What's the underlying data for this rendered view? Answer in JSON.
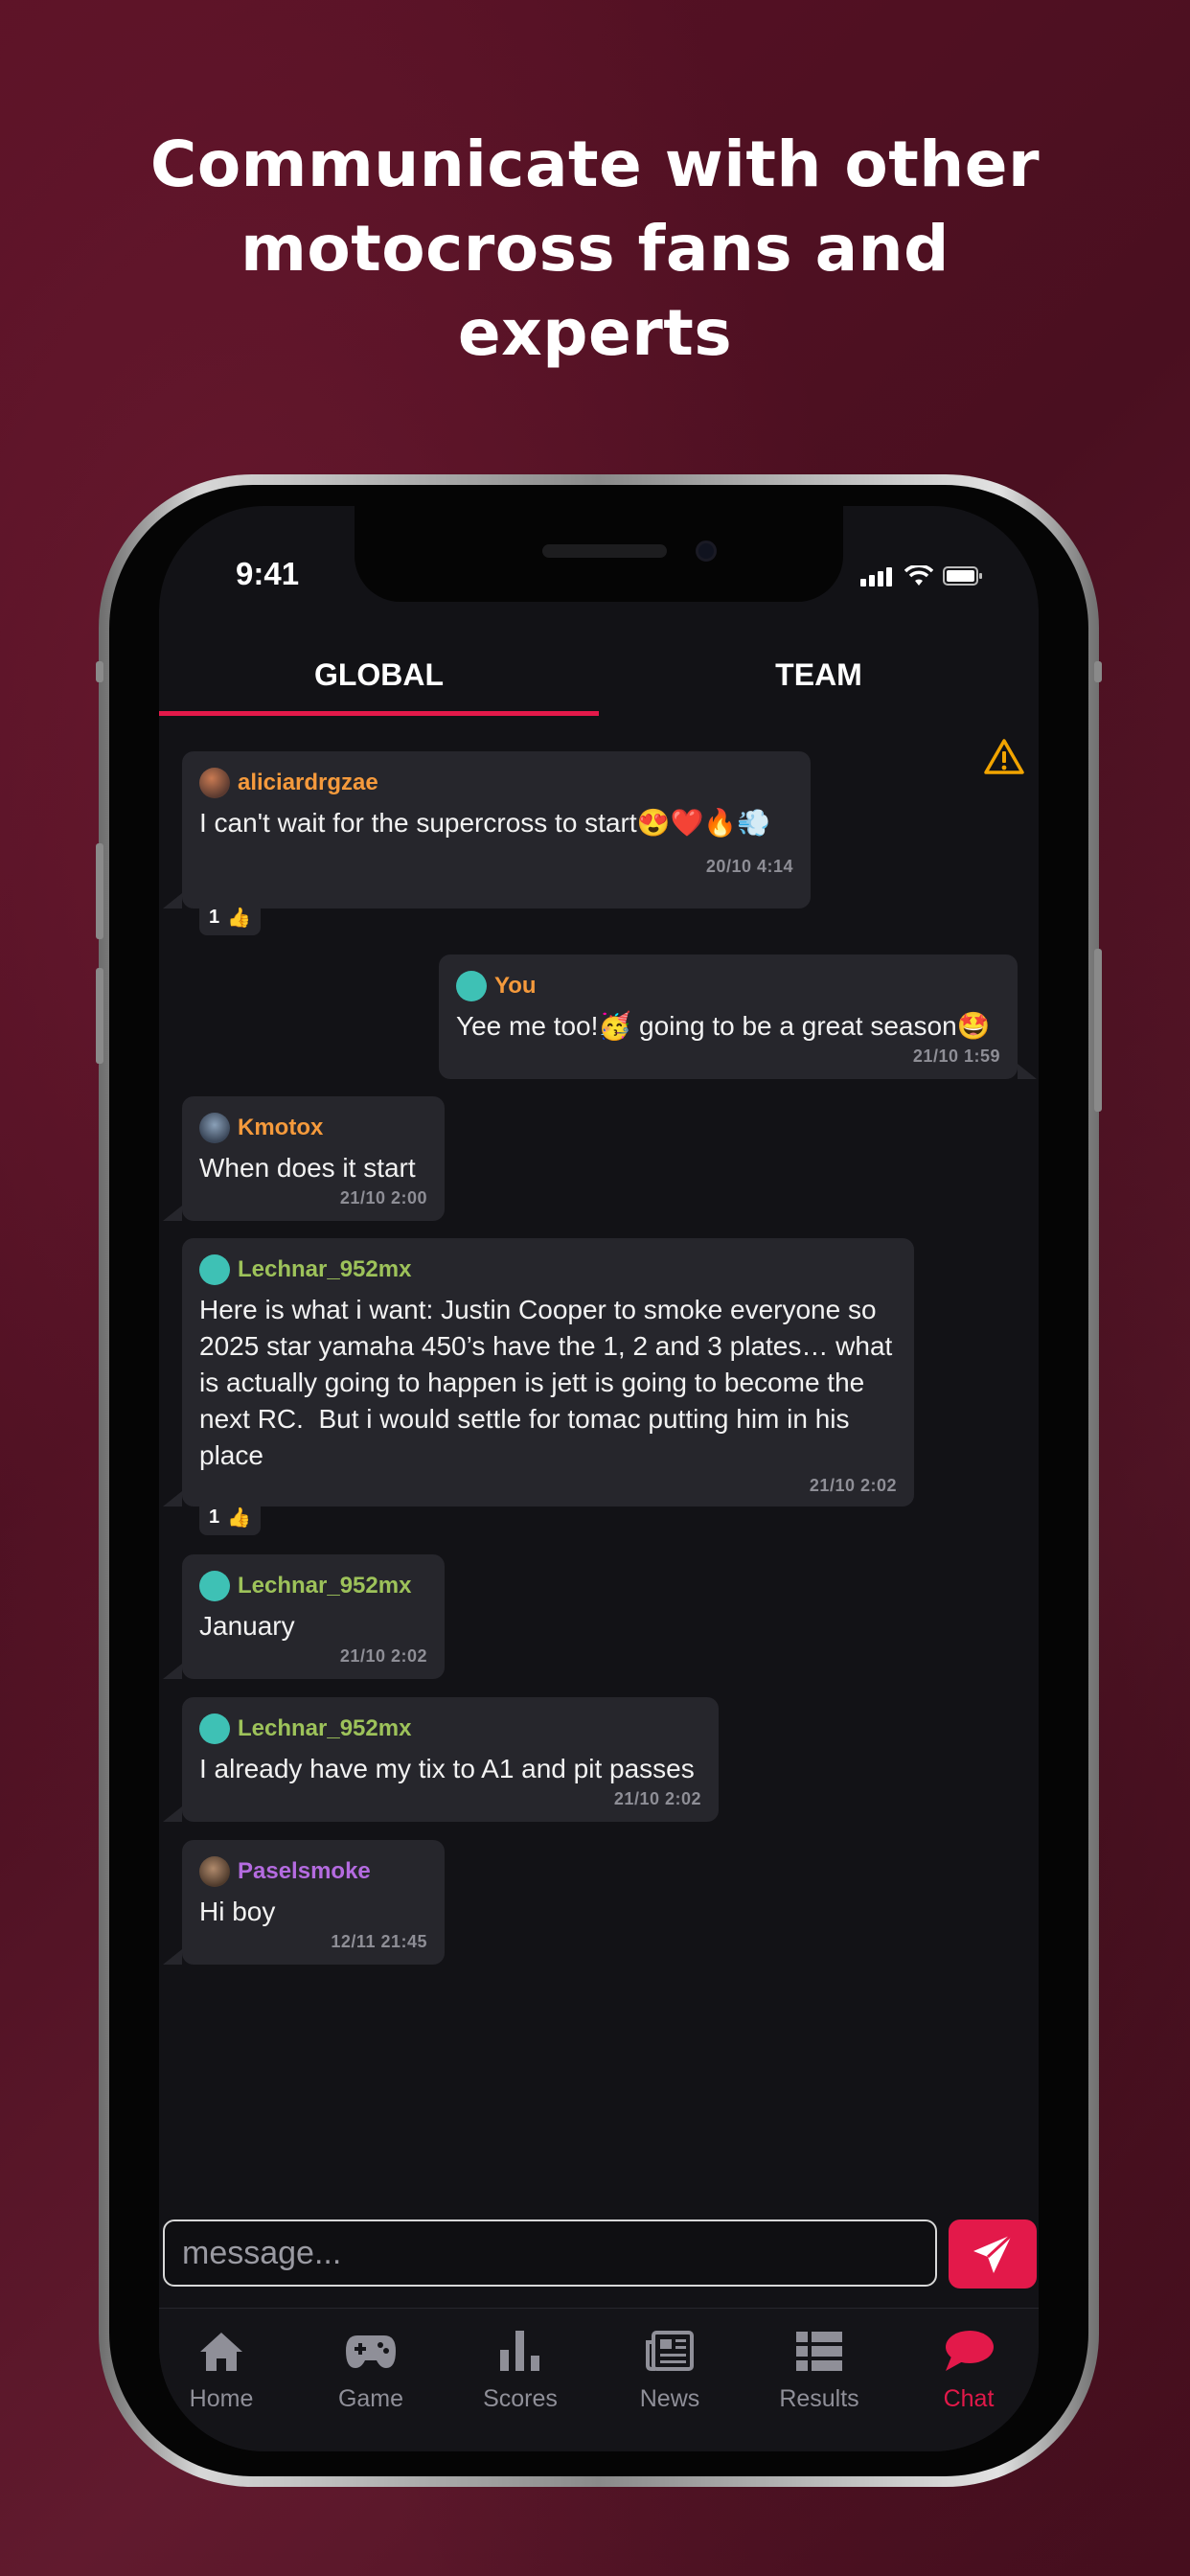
{
  "headline": "Communicate with other motocross fans and experts",
  "status_bar": {
    "time": "9:41"
  },
  "tabs": [
    {
      "label": "GLOBAL",
      "active": true
    },
    {
      "label": "TEAM",
      "active": false
    }
  ],
  "icons": {
    "warning": "warning-icon",
    "send": "send-icon"
  },
  "colors": {
    "accent": "#e3194a",
    "background": "#121216",
    "bubble": "#26262c",
    "warning": "#f2a400"
  },
  "messages": [
    {
      "user": "aliciardrgzae",
      "user_color": "#f59a3c",
      "text": "I can't wait for the supercross to start😍❤️🔥💨",
      "time": "20/10  4:14",
      "likes": "1",
      "mine": false
    },
    {
      "user": "You",
      "user_color": "#f59a3c",
      "text": "Yee me too!🥳 going to be a great season🤩",
      "time": "21/10  1:59",
      "mine": true
    },
    {
      "user": "Kmotox",
      "user_color": "#f59a3c",
      "text": "When does it start",
      "time": "21/10  2:00",
      "mine": false
    },
    {
      "user": "Lechnar_952mx",
      "user_color": "#9dc25a",
      "text": "Here is what i want: Justin Cooper to smoke everyone so 2025 star yamaha 450’s have the 1, 2 and 3 plates… what is actually going to happen is jett is going to become the next RC.  But i would settle for tomac putting him in his place",
      "time": "21/10  2:02",
      "likes": "1",
      "mine": false
    },
    {
      "user": "Lechnar_952mx",
      "user_color": "#9dc25a",
      "text": "January",
      "time": "21/10  2:02",
      "mine": false
    },
    {
      "user": "Lechnar_952mx",
      "user_color": "#9dc25a",
      "text": "I already have my tix to A1 and pit passes",
      "time": "21/10  2:02",
      "mine": false
    },
    {
      "user": "Paselsmoke",
      "user_color": "#b46be0",
      "text": "Hi boy",
      "time": "12/11  21:45",
      "mine": false
    }
  ],
  "composer": {
    "placeholder": "message..."
  },
  "nav": [
    {
      "label": "Home",
      "icon": "home-icon",
      "active": false
    },
    {
      "label": "Game",
      "icon": "gamepad-icon",
      "active": false
    },
    {
      "label": "Scores",
      "icon": "bar-chart-icon",
      "active": false
    },
    {
      "label": "News",
      "icon": "newspaper-icon",
      "active": false
    },
    {
      "label": "Results",
      "icon": "list-icon",
      "active": false
    },
    {
      "label": "Chat",
      "icon": "chat-bubble-icon",
      "active": true
    }
  ]
}
